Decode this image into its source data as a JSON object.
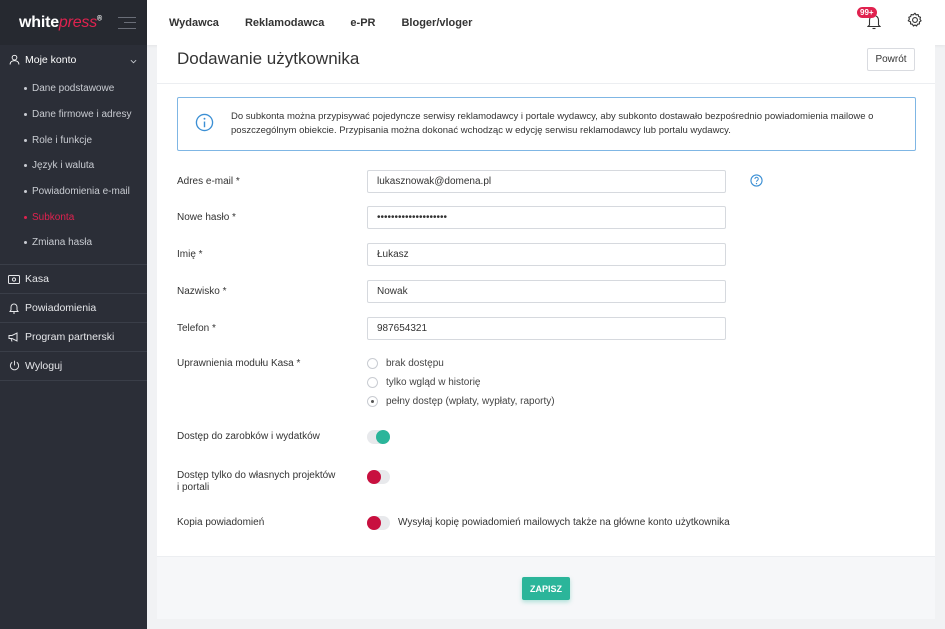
{
  "brand": {
    "logo_white": "white",
    "logo_press": "press",
    "logo_reg": "®"
  },
  "sidebar": {
    "account": {
      "label": "Moje konto",
      "items": [
        {
          "label": "Dane podstawowe",
          "active": false
        },
        {
          "label": "Dane firmowe i adresy",
          "active": false
        },
        {
          "label": "Role i funkcje",
          "active": false
        },
        {
          "label": "Język i waluta",
          "active": false
        },
        {
          "label": "Powiadomienia e-mail",
          "active": false
        },
        {
          "label": "Subkonta",
          "active": true
        },
        {
          "label": "Zmiana hasła",
          "active": false
        }
      ]
    },
    "kasa": "Kasa",
    "powiadomienia": "Powiadomienia",
    "program": "Program partnerski",
    "wyloguj": "Wyloguj"
  },
  "topnav": {
    "items": [
      "Wydawca",
      "Reklamodawca",
      "e-PR",
      "Bloger/vloger"
    ],
    "notifications_badge": "99+"
  },
  "page": {
    "title": "Dodawanie użytkownika",
    "back_label": "Powrót",
    "info": "Do subkonta można przypisywać pojedyncze serwisy reklamodawcy i portale wydawcy, aby subkonto dostawało bezpośrednio powiadomienia mailowe o poszczególnym obiekcie. Przypisania można dokonać wchodząc w edycję serwisu reklamodawcy lub portalu wydawcy."
  },
  "form": {
    "email": {
      "label": "Adres e-mail *",
      "value": "lukasznowak@domena.pl"
    },
    "password": {
      "label": "Nowe hasło *",
      "value": "••••••••••••••••••••"
    },
    "first_name": {
      "label": "Imię *",
      "value": "Łukasz"
    },
    "last_name": {
      "label": "Nazwisko *",
      "value": "Nowak"
    },
    "phone": {
      "label": "Telefon *",
      "value": "987654321"
    },
    "kasa_perms": {
      "label": "Uprawnienia modułu Kasa *",
      "options": [
        {
          "label": "brak dostępu",
          "selected": false
        },
        {
          "label": "tylko wgląd w historię",
          "selected": false
        },
        {
          "label": "pełny dostęp (wpłaty, wypłaty, raporty)",
          "selected": true
        }
      ]
    },
    "earnings_access": {
      "label": "Dostęp do zarobków i wydatków",
      "on": true
    },
    "own_projects": {
      "label": "Dostęp tylko do własnych projektów i portali",
      "on": false
    },
    "notif_copy": {
      "label": "Kopia powiadomień",
      "on": false,
      "text": "Wysyłaj kopię powiadomień mailowych także na główne konto użytkownika"
    },
    "save_label": "ZAPISZ"
  },
  "colors": {
    "accent": "#e0224f",
    "success": "#2bb59a",
    "sidebar": "#2b2e37",
    "info_border": "#7fb6e4"
  }
}
